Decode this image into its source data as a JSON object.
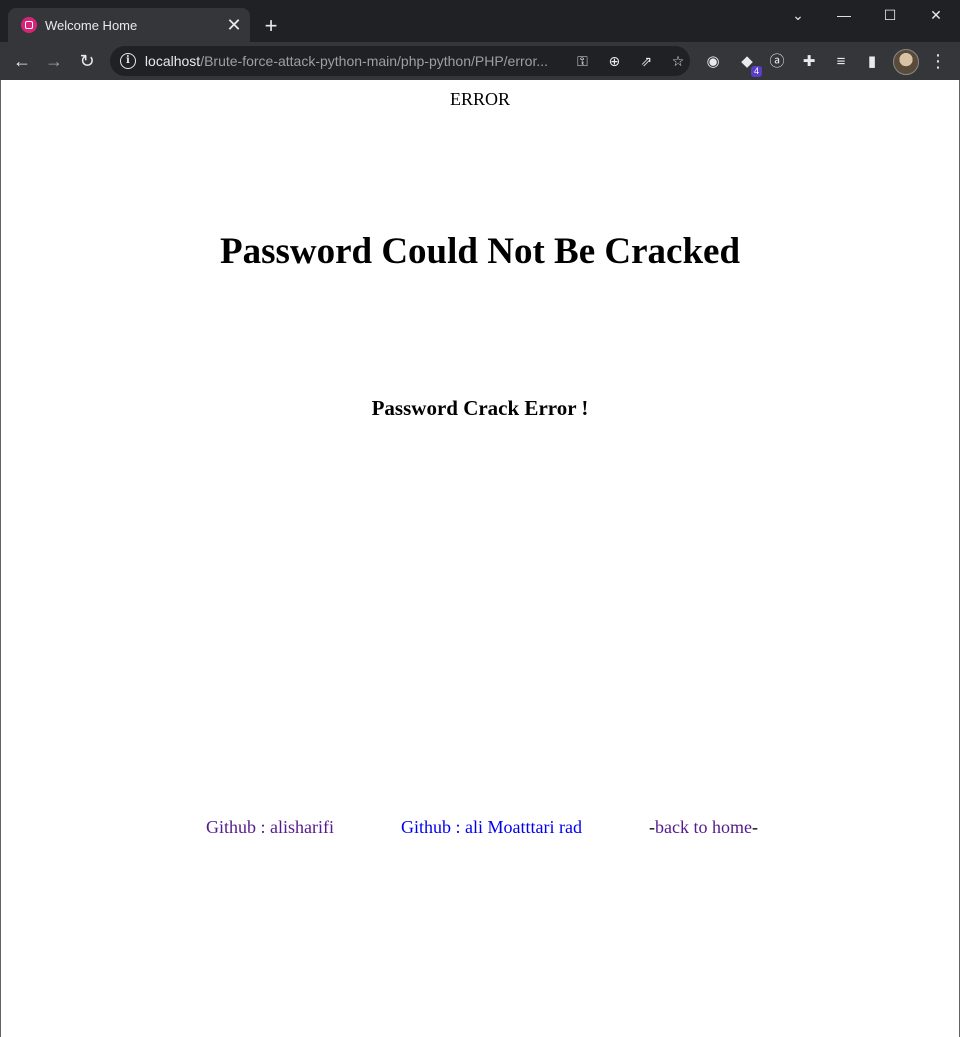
{
  "browser": {
    "tab_title": "Welcome Home",
    "url_host": "localhost",
    "url_path": "/Brute-force-attack-python-main/php-python/PHP/error...",
    "extension_badge": "4",
    "icons": [
      "favicon-icon",
      "close-icon",
      "plus-icon",
      "chevron-down-icon",
      "minimize-icon",
      "maximize-icon",
      "close-window-icon",
      "back-arrow-icon",
      "forward-arrow-icon",
      "reload-icon",
      "info-icon",
      "key-icon",
      "zoom-icon",
      "share-icon",
      "star-icon",
      "grammarly-icon",
      "extension-badge-icon",
      "amazon-icon",
      "puzzle-icon",
      "media-queue-icon",
      "side-panel-icon",
      "avatar",
      "more-menu-icon"
    ]
  },
  "page": {
    "top_text": "ERROR",
    "heading": "Password Could Not Be Cracked",
    "subheading": "Password Crack Error !",
    "footer": {
      "link1": "Github : alisharifi",
      "link2": "Github : ali Moatttari rad",
      "back_prefix": "-",
      "back_label": "back to home",
      "back_suffix": "-"
    }
  },
  "colors": {
    "visited_link": "#551a8b",
    "link": "#0000ee",
    "chrome_dark": "#202124",
    "chrome_toolbar": "#35363a"
  }
}
